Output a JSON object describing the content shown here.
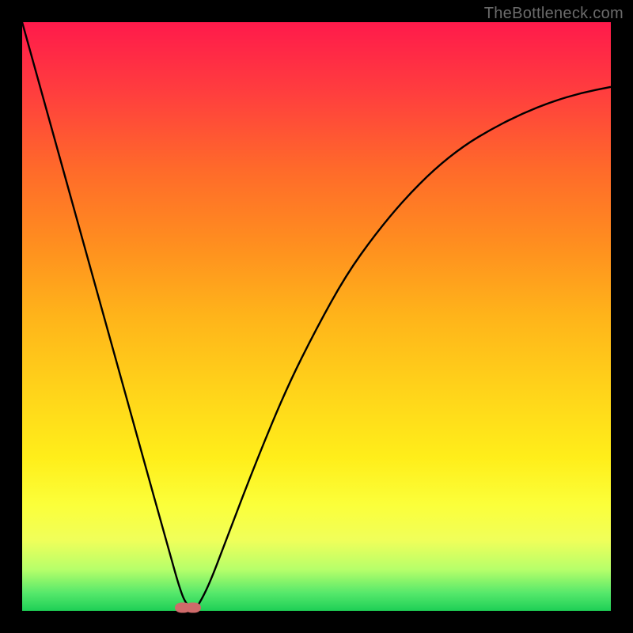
{
  "watermark": "TheBottleneck.com",
  "chart_data": {
    "type": "line",
    "title": "",
    "xlabel": "",
    "ylabel": "",
    "xlim": [
      0,
      100
    ],
    "ylim": [
      0,
      100
    ],
    "grid": false,
    "series": [
      {
        "name": "bottleneck-curve",
        "x": [
          0,
          5,
          10,
          15,
          20,
          25,
          27,
          28,
          29,
          30,
          32,
          35,
          40,
          45,
          50,
          55,
          60,
          65,
          70,
          75,
          80,
          85,
          90,
          95,
          100
        ],
        "values": [
          100,
          82,
          64,
          46,
          28,
          10,
          3,
          1,
          0,
          1,
          5,
          13,
          26,
          38,
          48,
          57,
          64,
          70,
          75,
          79,
          82,
          84.5,
          86.5,
          88,
          89
        ]
      }
    ],
    "markers": [
      {
        "name": "valley-dot-1",
        "x": 27.3,
        "y": 0.5
      },
      {
        "name": "valley-dot-2",
        "x": 29.0,
        "y": 0.5
      }
    ],
    "background_gradient": {
      "top": "#ff1a4b",
      "bottom": "#1ecf56"
    }
  }
}
